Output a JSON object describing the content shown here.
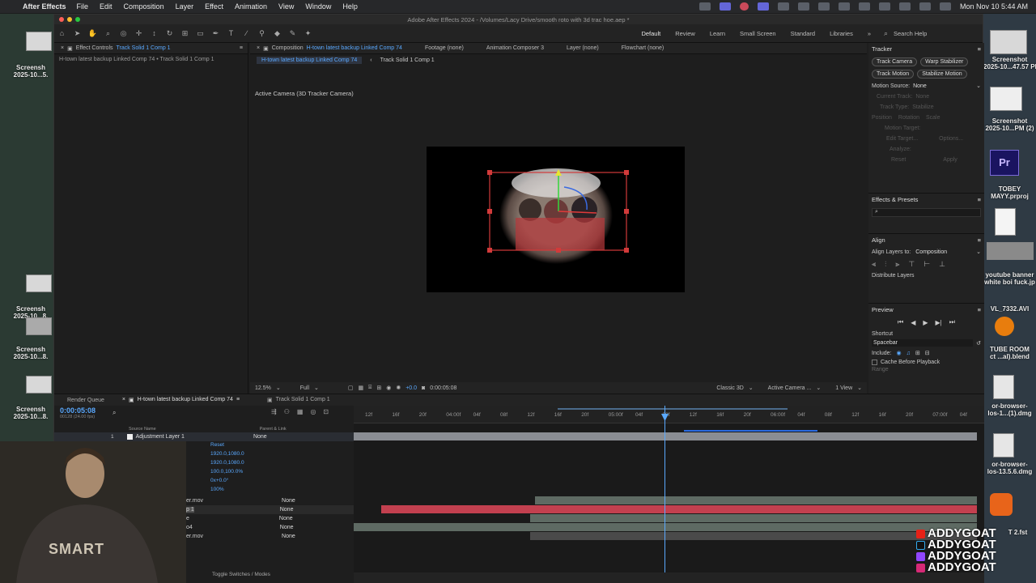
{
  "menubar": {
    "app": "After Effects",
    "items": [
      "File",
      "Edit",
      "Composition",
      "Layer",
      "Effect",
      "Animation",
      "View",
      "Window",
      "Help"
    ],
    "clock": "Mon Nov 10  5:44 AM"
  },
  "desktop_left": {
    "labels": [
      "Screensh\n2025-10...5.",
      "Screensh\n2025-10...8.",
      "Screensh\n2025-10...8.",
      "Screensh\n2025-10...8."
    ]
  },
  "desktop_right": {
    "labels": [
      "Screenshot\n2025-10...47.57 PM",
      "Screenshot\n2025-10...PM (2)",
      "TOBEY\nMAYY.prproj",
      "youtube banner\nwhite boi fuck.jp",
      "VL_7332.AVI",
      "TUBE ROOM\nct ...al).blend",
      "or-browser-\nlos-1...(1).dmg",
      "or-browser-\nlos-13.5.6.dmg",
      "T 2.fst"
    ]
  },
  "ae": {
    "window_title": "Adobe After Effects 2024 - /Volumes/Lacy Drive/smooth roto with 3d trac hoe.aep *",
    "workspaces": [
      "Default",
      "Review",
      "Learn",
      "Small Screen",
      "Standard",
      "Libraries"
    ],
    "search_placeholder": "Search Help",
    "effect_controls_tab": "Effect Controls",
    "effect_controls_layer": "Track Solid 1 Comp 1",
    "effect_controls_path": "H-town latest backup Linked Comp 74 • Track Solid 1 Comp 1",
    "composition_tab": "Composition",
    "composition_name": "H-town latest backup Linked Comp 74",
    "footage_tab": "Footage (none)",
    "anim_composer_tab": "Animation Composer 3",
    "layer_tab": "Layer (none)",
    "flowchart_tab": "Flowchart (none)",
    "comp_subtab_1": "H-town latest backup Linked Comp 74",
    "comp_subtab_2": "Track Solid 1 Comp 1",
    "viewer_label": "Active Camera (3D Tracker Camera)",
    "zoom": "12.5%",
    "resolution": "Full",
    "exposure": "+0.0",
    "footer_timecode": "0:00:05:08",
    "renderer": "Classic 3D",
    "camera_view": "Active Camera ...",
    "views": "1 View"
  },
  "tracker": {
    "title": "Tracker",
    "buttons": [
      "Track Camera",
      "Warp Stabilizer",
      "Track Motion",
      "Stabilize Motion"
    ],
    "motion_source_label": "Motion Source:",
    "motion_source_value": "None",
    "current_track": "Current Track:",
    "current_track_value": "None",
    "track_type": "Track Type:",
    "track_type_value": "Stabilize",
    "checks": [
      "Position",
      "Rotation",
      "Scale"
    ],
    "motion_target": "Motion Target:",
    "edit_target": "Edit Target...",
    "options": "Options...",
    "analyze": "Analyze:",
    "reset": "Reset",
    "apply": "Apply"
  },
  "effects_presets": {
    "title": "Effects & Presets"
  },
  "align": {
    "title": "Align",
    "align_to_label": "Align Layers to:",
    "align_to_value": "Composition",
    "distribute": "Distribute Layers"
  },
  "preview": {
    "title": "Preview",
    "shortcut_label": "Shortcut",
    "shortcut_value": "Spacebar",
    "include": "Include:",
    "cache": "Cache Before Playback",
    "range": "Range"
  },
  "timeline": {
    "tab_render": "Render Queue",
    "tab_comp": "H-town latest backup Linked Comp 74",
    "tab_track": "Track Solid 1 Comp 1",
    "timecode": "0:00:05:08",
    "frames": "00128 (24.00 fps)",
    "col_source": "Source Name",
    "col_parent": "Parent & Link",
    "layer1_num": "1",
    "layer1_name": "Adjustment Layer 1",
    "layer1_parent": "None",
    "reset": "Reset",
    "props": [
      "1920.0,1080.0",
      "1920.0,1080.0",
      "100.0,100.0%",
      "0x+0.0°",
      "100%"
    ],
    "sub_layers": [
      {
        "name": "er.mov",
        "parent": "None"
      },
      {
        "name": "p 1",
        "parent": "None"
      },
      {
        "name": "e",
        "parent": "None"
      },
      {
        "name": "o4",
        "parent": "None"
      },
      {
        "name": "er.mov",
        "parent": "None"
      }
    ],
    "ruler": [
      "12f",
      "16f",
      "20f",
      "04:00f",
      "04f",
      "08f",
      "12f",
      "16f",
      "20f",
      "05:00f",
      "04f",
      "08f",
      "12f",
      "16f",
      "20f",
      "06:00f",
      "04f",
      "08f",
      "12f",
      "16f",
      "20f",
      "07:00f",
      "04f"
    ],
    "toggle": "Toggle Switches / Modes"
  },
  "watermark": {
    "text": "ADDYGOAT",
    "rows": 4
  },
  "webcam_shirt": "SMART"
}
